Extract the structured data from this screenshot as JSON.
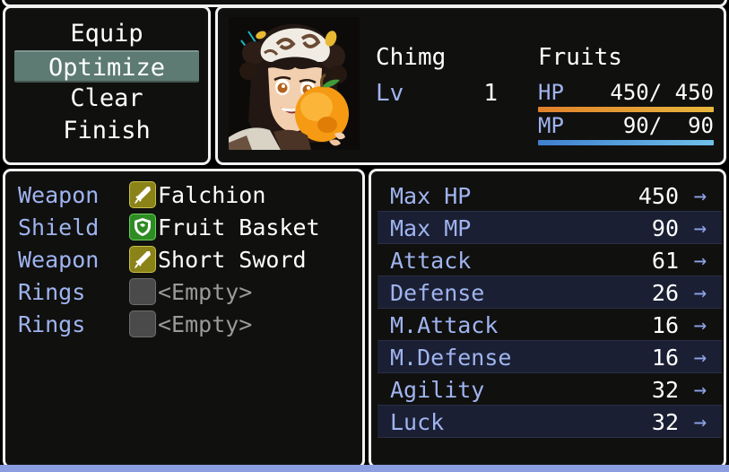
{
  "command_menu": {
    "items": [
      {
        "label": "Equip",
        "selected": false
      },
      {
        "label": "Optimize",
        "selected": true
      },
      {
        "label": "Clear",
        "selected": false
      },
      {
        "label": "Finish",
        "selected": false
      }
    ]
  },
  "status": {
    "actor_name": "Chimg",
    "level_label": "Lv",
    "level_value": "1",
    "class_name": "Fruits",
    "hp": {
      "label": "HP",
      "value_text": "450/ 450",
      "current": 450,
      "max": 450,
      "fill_percent": 100,
      "color_start": "#e0812c",
      "color_end": "#e8b73c"
    },
    "mp": {
      "label": "MP",
      "value_text": " 90/  90",
      "current": 90,
      "max": 90,
      "fill_percent": 100,
      "color_start": "#3f7fd0",
      "color_end": "#6fc0e8"
    },
    "face": {
      "icon": "character-portrait",
      "description": "anime girl with dark hair buns and white patterned headdress holding an orange fruit"
    }
  },
  "equipment": {
    "slots": [
      {
        "label": "Weapon",
        "item": "Falchion",
        "icon": "sword-icon",
        "icon_kind": "weapon",
        "empty": false
      },
      {
        "label": "Shield",
        "item": "Fruit Basket",
        "icon": "shield-icon",
        "icon_kind": "shield",
        "empty": false
      },
      {
        "label": "Weapon",
        "item": "Short Sword",
        "icon": "sword-icon",
        "icon_kind": "weapon",
        "empty": false
      },
      {
        "label": "Rings",
        "item": "<Empty>",
        "icon": "empty-slot-icon",
        "icon_kind": "empty",
        "empty": true
      },
      {
        "label": "Rings",
        "item": "<Empty>",
        "icon": "empty-slot-icon",
        "icon_kind": "empty",
        "empty": true
      }
    ]
  },
  "parameters": {
    "arrow_glyph": "→",
    "rows": [
      {
        "label": "Max HP",
        "value": "450"
      },
      {
        "label": "Max MP",
        "value": "90"
      },
      {
        "label": "Attack",
        "value": "61"
      },
      {
        "label": "Defense",
        "value": "26"
      },
      {
        "label": "M.Attack",
        "value": "16"
      },
      {
        "label": "M.Defense",
        "value": "16"
      },
      {
        "label": "Agility",
        "value": "32"
      },
      {
        "label": "Luck",
        "value": "32"
      }
    ]
  },
  "theme": {
    "window_border": "#f2f2f2",
    "window_fill": "#10100f",
    "label_blue": "#9fb4ef",
    "cursor_highlight": "#5d7a73",
    "bottom_strip": "#8a9de0"
  }
}
